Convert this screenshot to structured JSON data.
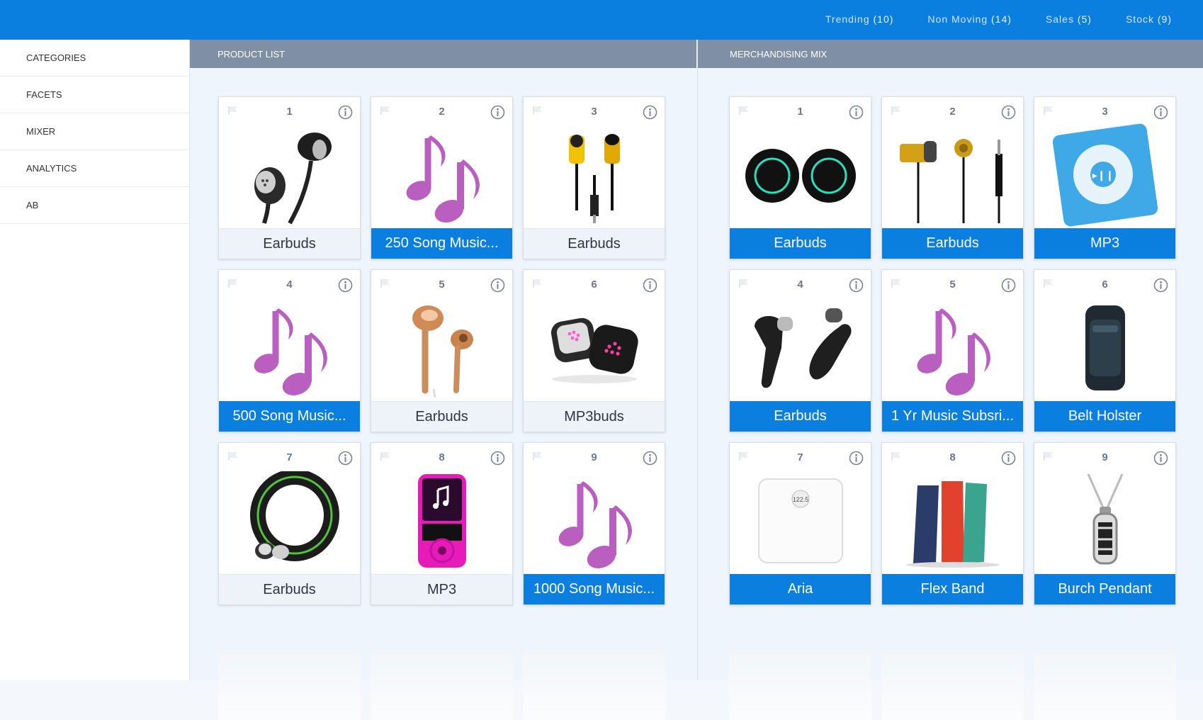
{
  "topnav": [
    {
      "label": "Trending",
      "count": "(10)"
    },
    {
      "label": "Non Moving",
      "count": "(14)"
    },
    {
      "label": "Sales",
      "count": "(5)"
    },
    {
      "label": "Stock",
      "count": "(9)"
    }
  ],
  "sidebar": {
    "items": [
      {
        "label": "CATEGORIES"
      },
      {
        "label": "FACETS"
      },
      {
        "label": "MIXER"
      },
      {
        "label": "ANALYTICS"
      },
      {
        "label": "AB"
      }
    ]
  },
  "product_list": {
    "title": "PRODUCT LIST",
    "cards": [
      {
        "num": "1",
        "label": "Earbuds",
        "highlight": false,
        "icon": "earbuds-black-icon"
      },
      {
        "num": "2",
        "label": "250 Song Music...",
        "highlight": true,
        "icon": "music-note-icon"
      },
      {
        "num": "3",
        "label": "Earbuds",
        "highlight": false,
        "icon": "earbuds-yellow-icon"
      },
      {
        "num": "4",
        "label": "500 Song Music...",
        "highlight": true,
        "icon": "music-note-icon"
      },
      {
        "num": "5",
        "label": "Earbuds",
        "highlight": false,
        "icon": "earbuds-rosegold-icon"
      },
      {
        "num": "6",
        "label": "MP3buds",
        "highlight": false,
        "icon": "mp3buds-icon"
      },
      {
        "num": "7",
        "label": "Earbuds",
        "highlight": false,
        "icon": "ring-earbuds-icon"
      },
      {
        "num": "8",
        "label": "MP3",
        "highlight": false,
        "icon": "mp3-player-icon"
      },
      {
        "num": "9",
        "label": "1000 Song Music...",
        "highlight": true,
        "icon": "music-note-icon"
      }
    ]
  },
  "merch_mix": {
    "title": "MERCHANDISING MIX",
    "cards": [
      {
        "num": "1",
        "label": "Earbuds",
        "highlight": true,
        "icon": "wireless-earbuds-icon"
      },
      {
        "num": "2",
        "label": "Earbuds",
        "highlight": true,
        "icon": "earbuds-gold-icon"
      },
      {
        "num": "3",
        "label": "MP3",
        "highlight": true,
        "icon": "ipod-shuffle-icon"
      },
      {
        "num": "4",
        "label": "Earbuds",
        "highlight": true,
        "icon": "earbuds-dark-icon"
      },
      {
        "num": "5",
        "label": "1 Yr Music Subsri...",
        "highlight": true,
        "icon": "music-note-icon"
      },
      {
        "num": "6",
        "label": "Belt Holster",
        "highlight": true,
        "icon": "belt-holster-icon"
      },
      {
        "num": "7",
        "label": "Aria",
        "highlight": true,
        "icon": "scale-icon"
      },
      {
        "num": "8",
        "label": "Flex Band",
        "highlight": true,
        "icon": "flex-band-icon"
      },
      {
        "num": "9",
        "label": "Burch Pendant",
        "highlight": true,
        "icon": "pendant-icon"
      }
    ]
  },
  "colors": {
    "accent": "#0a7fe0",
    "header_gray": "#7f8fa6",
    "music_note": "#b85fbf"
  }
}
